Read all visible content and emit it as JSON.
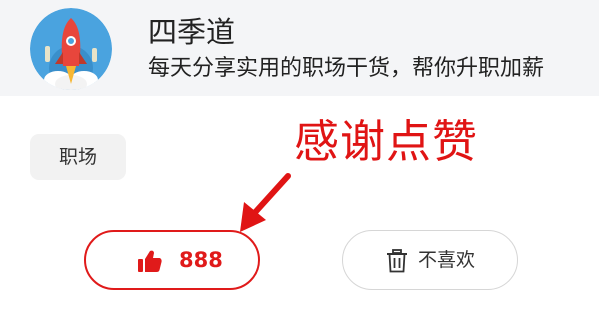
{
  "channel": {
    "name": "四季道",
    "description": "每天分享实用的职场干货，帮你升职加薪"
  },
  "tag": {
    "label": "职场"
  },
  "annotation": {
    "text": "感谢点赞",
    "color": "#e01414"
  },
  "like_button": {
    "count": "888",
    "icon": "thumbs-up-icon",
    "color": "#e01a1a"
  },
  "dislike_button": {
    "label": "不喜欢",
    "icon": "trash-icon"
  },
  "colors": {
    "header_bg": "#f4f5f7",
    "tag_bg": "#f2f2f2",
    "avatar_bg": "#4aa3df"
  }
}
